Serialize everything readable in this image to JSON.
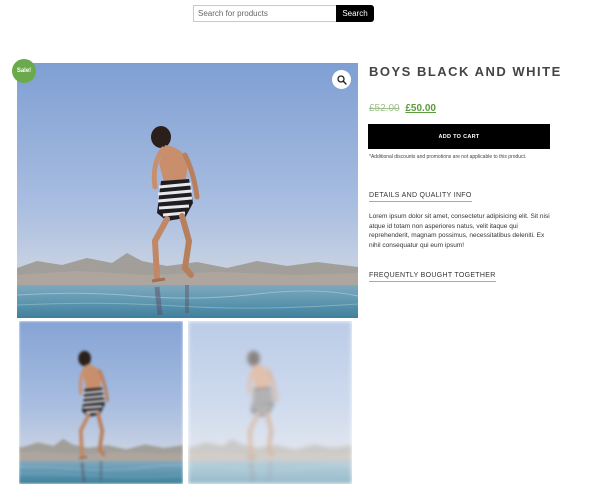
{
  "search": {
    "placeholder": "Search for products",
    "button_label": "Search"
  },
  "product": {
    "sale_badge": "Sale!",
    "title": "BOYS BLACK AND WHITE",
    "old_price": "£52.00",
    "new_price": "£50.00",
    "add_to_cart_label": "ADD TO CART",
    "note": "*Additional discounts and promotions are not applicable to this product.",
    "details_heading": "DETAILS AND QUALITY INFO",
    "description": "Lorem ipsum dolor sit amet, consectetur adipisicing elit. Sit nisi atque id totam non asperiores natus, velit itaque qui reprehenderit, magnam possimus, necessitatibus deleniti. Ex nihil consequatur qui eum ipsum!",
    "bought_heading": "FREQUENTLY BOUGHT TOGETHER"
  },
  "colors": {
    "sale_badge": "#6aaa4a",
    "price": "#5a9c3c",
    "button": "#000000",
    "link_underline": "#d89a7a"
  },
  "icons": {
    "zoom": "magnifier-icon"
  }
}
